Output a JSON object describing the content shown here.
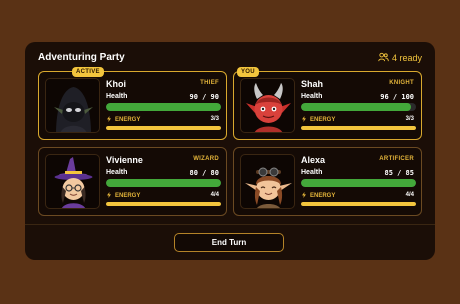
{
  "panel": {
    "title": "Adventuring Party",
    "ready_text": "4 ready"
  },
  "colors": {
    "accent": "#f3c53d",
    "health": "#43a83a",
    "card_border": "#6b4a22",
    "highlight_border": "#d9a92e"
  },
  "cards": [
    {
      "name": "Khoi",
      "class": "THIEF",
      "badge": "ACTIVE",
      "health_label": "Health",
      "hp_text": "90 / 90",
      "hp_fraction": 1.0,
      "energy_label": "ENERGY",
      "energy_text": "3/3",
      "energy_fraction": 1.0,
      "portrait": "hooded-goblin"
    },
    {
      "name": "Shah",
      "class": "KNIGHT",
      "badge": "YOU",
      "health_label": "Health",
      "hp_text": "96 / 100",
      "hp_fraction": 0.96,
      "energy_label": "ENERGY",
      "energy_text": "3/3",
      "energy_fraction": 1.0,
      "portrait": "red-demon"
    },
    {
      "name": "Vivienne",
      "class": "WIZARD",
      "health_label": "Health",
      "hp_text": "80 / 80",
      "hp_fraction": 1.0,
      "energy_label": "ENERGY",
      "energy_text": "4/4",
      "energy_fraction": 1.0,
      "portrait": "witch"
    },
    {
      "name": "Alexa",
      "class": "ARTIFICER",
      "health_label": "Health",
      "hp_text": "85 / 85",
      "hp_fraction": 1.0,
      "energy_label": "ENERGY",
      "energy_text": "4/4",
      "energy_fraction": 1.0,
      "portrait": "elf-goggles"
    }
  ],
  "actions": {
    "end_turn": "End Turn"
  }
}
